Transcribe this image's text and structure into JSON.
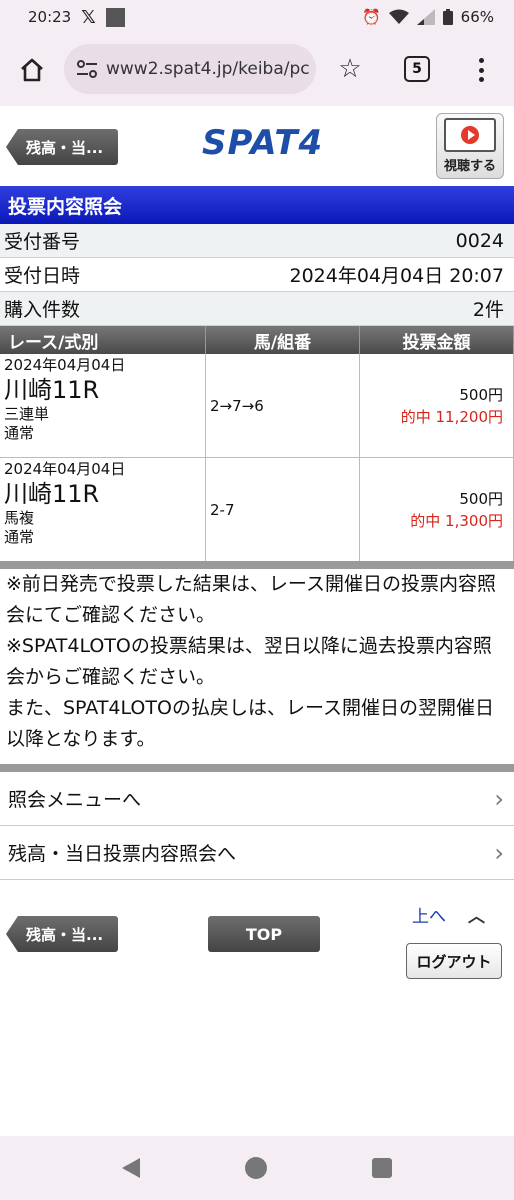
{
  "status_bar": {
    "time": "20:23",
    "battery": "66%"
  },
  "browser": {
    "url": "www2.spat4.jp/keiba/pc",
    "tab_count": "5"
  },
  "header": {
    "back_label": "残高・当...",
    "logo_text": "SPAT4",
    "watch_label": "視聴する"
  },
  "section_title": "投票内容照会",
  "info": {
    "receipt_label": "受付番号",
    "receipt_value": "0024",
    "datetime_label": "受付日時",
    "datetime_value": "2024年04月04日 20:07",
    "count_label": "購入件数",
    "count_value": "2件"
  },
  "table": {
    "headers": [
      "レース/式別",
      "馬/組番",
      "投票金額"
    ],
    "rows": [
      {
        "date": "2024年04月04日",
        "venue": "川崎11R",
        "bet_type": "三連単",
        "mode": "通常",
        "combo": "2→7→6",
        "amount": "500円",
        "hit": "的中 11,200円"
      },
      {
        "date": "2024年04月04日",
        "venue": "川崎11R",
        "bet_type": "馬複",
        "mode": "通常",
        "combo": "2-7",
        "amount": "500円",
        "hit": "的中 1,300円"
      }
    ]
  },
  "notes": [
    "※前日発売で投票した結果は、レース開催日の投票内容照会にてご確認ください。",
    "※SPAT4LOTOの投票結果は、翌日以降に過去投票内容照会からご確認ください。",
    "また、SPAT4LOTOの払戻しは、レース開催日の翌開催日以降となります。"
  ],
  "menu": {
    "inquiry_menu": "照会メニューへ",
    "balance_inquiry": "残高・当日投票内容照会へ"
  },
  "footer": {
    "back_label": "残高・当...",
    "top_label": "TOP",
    "up_label": "上へ",
    "logout_label": "ログアウト"
  }
}
